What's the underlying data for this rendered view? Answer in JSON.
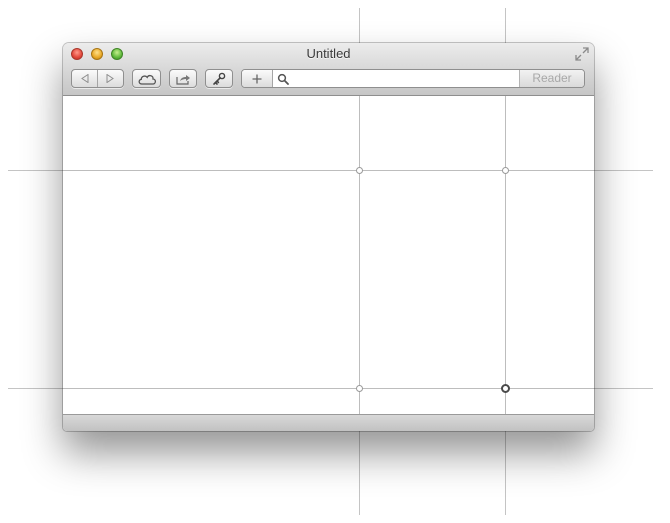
{
  "window": {
    "title": "Untitled",
    "traffic_lights": [
      "close",
      "minimize",
      "zoom"
    ]
  },
  "toolbar": {
    "back_icon": "chevron-left-icon",
    "forward_icon": "chevron-right-icon",
    "icloud_icon": "cloud-icon",
    "share_icon": "share-icon",
    "key_icon": "key-icon",
    "add_icon": "plus-icon",
    "search_icon": "magnifier-icon",
    "address_value": "",
    "reader_label": "Reader"
  },
  "colors": {
    "titlebar_top": "#ececec",
    "titlebar_bottom": "#c6c6c6",
    "close": "#e2463a",
    "minimize": "#e9a826",
    "zoom": "#5fb93b",
    "guide_line": "#c4c4c4"
  }
}
